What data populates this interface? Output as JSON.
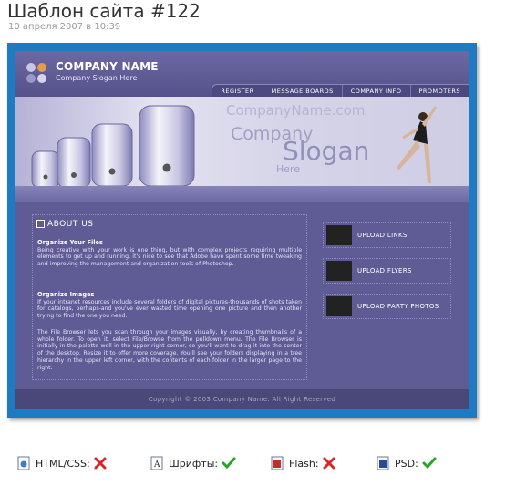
{
  "post": {
    "title": "Шаблон сайта #122",
    "date": "10 апреля 2007 в 10:39"
  },
  "template": {
    "company_name": "COMPANY NAME",
    "company_slogan": "Company Slogan Here",
    "nav": [
      "REGISTER",
      "MESSAGE BOARDS",
      "COMPANY INFO",
      "PROMOTERS"
    ],
    "hero": {
      "watermark": "CompanyName.com",
      "company": "Company",
      "slogan": "Slogan",
      "here": "Here"
    },
    "about": {
      "title": "ABOUT US",
      "h1": "Organize Your Files",
      "p1": "Being creative with your work is one thing, but with complex projects requiring multiple elements to get up and running, it's nice to see that Adobe have spent some time tweaking and improving the management and organization tools of Photoshop.",
      "h2": "Organize Images",
      "p2": "If your intranet resources include several folders of digital pictures-thousands of shots taken for catalogs, perhaps-and you've ever wasted time opening one picture and then another trying to find the one you need.",
      "p3": "The File Browser lets you scan through your images visually, by creating thumbnails of a whole folder. To open it, select File/Browse from the pulldown menu. The File Browser is initially in the palette well in the upper right corner, so you'll want to drag it into the center of the desktop. Resize it to offer more coverage. You'll see your folders displaying in a tree hierarchy in the upper left corner, with the contents of each folder in the larger page to the right."
    },
    "side": [
      "UPLOAD LINKS",
      "UPLOAD FLYERS",
      "UPLOAD PARTY PHOTOS"
    ],
    "footer": "Copyright © 2003 Company Name. All Right Reserved"
  },
  "features": [
    {
      "label": "HTML/CSS:",
      "icon": "html-file-icon",
      "status": "no"
    },
    {
      "label": "Шрифты:",
      "icon": "font-file-icon",
      "status": "yes"
    },
    {
      "label": "Flash:",
      "icon": "flash-file-icon",
      "status": "no"
    },
    {
      "label": "PSD:",
      "icon": "psd-file-icon",
      "status": "yes"
    }
  ],
  "colors": {
    "frame": "#1e7bc1",
    "site_bg": "#5d5a92",
    "yes": "#2aa52a",
    "no": "#d8262b"
  }
}
